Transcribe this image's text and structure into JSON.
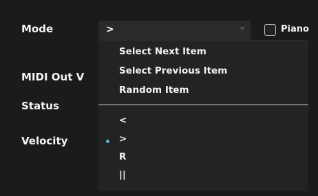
{
  "labels": {
    "mode": "Mode",
    "midi_out": "MIDI Out V",
    "status": "Status",
    "velocity": "Velocity"
  },
  "mode_select": {
    "value": ">"
  },
  "piano_checkbox": {
    "label": "Piano",
    "checked": false
  },
  "dropdown": {
    "actions": [
      "Select Next Item",
      "Select Previous Item",
      "Random Item"
    ],
    "options": [
      "<",
      ">",
      "R",
      "||"
    ],
    "selected_index": 1
  },
  "colors": {
    "background": "#1b1b1b",
    "selection_bullet": "#56b7e6"
  }
}
